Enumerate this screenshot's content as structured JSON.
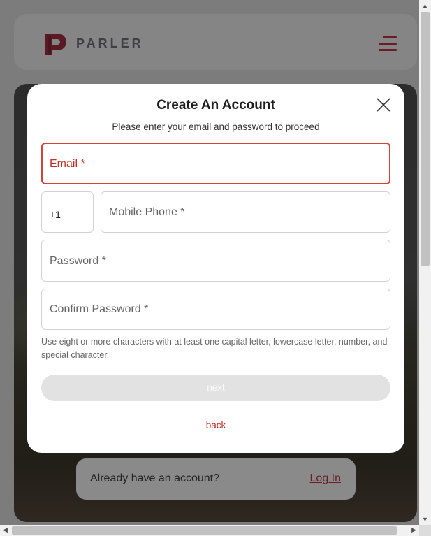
{
  "header": {
    "brand_name": "PARLER",
    "logo_icon": "parler-logo-icon",
    "menu_icon": "hamburger-menu-icon"
  },
  "modal": {
    "title": "Create An Account",
    "subtitle": "Please enter your email and password to proceed",
    "email": {
      "label": "Email *",
      "value": "",
      "state": "error"
    },
    "country_code": {
      "value": "+1"
    },
    "mobile": {
      "label": "Mobile Phone *",
      "value": ""
    },
    "password": {
      "label": "Password *",
      "value": ""
    },
    "confirm_password": {
      "label": "Confirm Password *",
      "value": ""
    },
    "hint": "Use eight or more characters with at least one capital letter, lowercase letter, number, and special character.",
    "next_label": "next",
    "back_label": "back",
    "close_icon": "close-icon"
  },
  "login_bar": {
    "question": "Already have an account?",
    "link_label": "Log In"
  },
  "colors": {
    "brand": "#6a1c28",
    "error": "#d0453b",
    "back_link": "#c0261d",
    "disabled_button": "#e2e2e2"
  }
}
